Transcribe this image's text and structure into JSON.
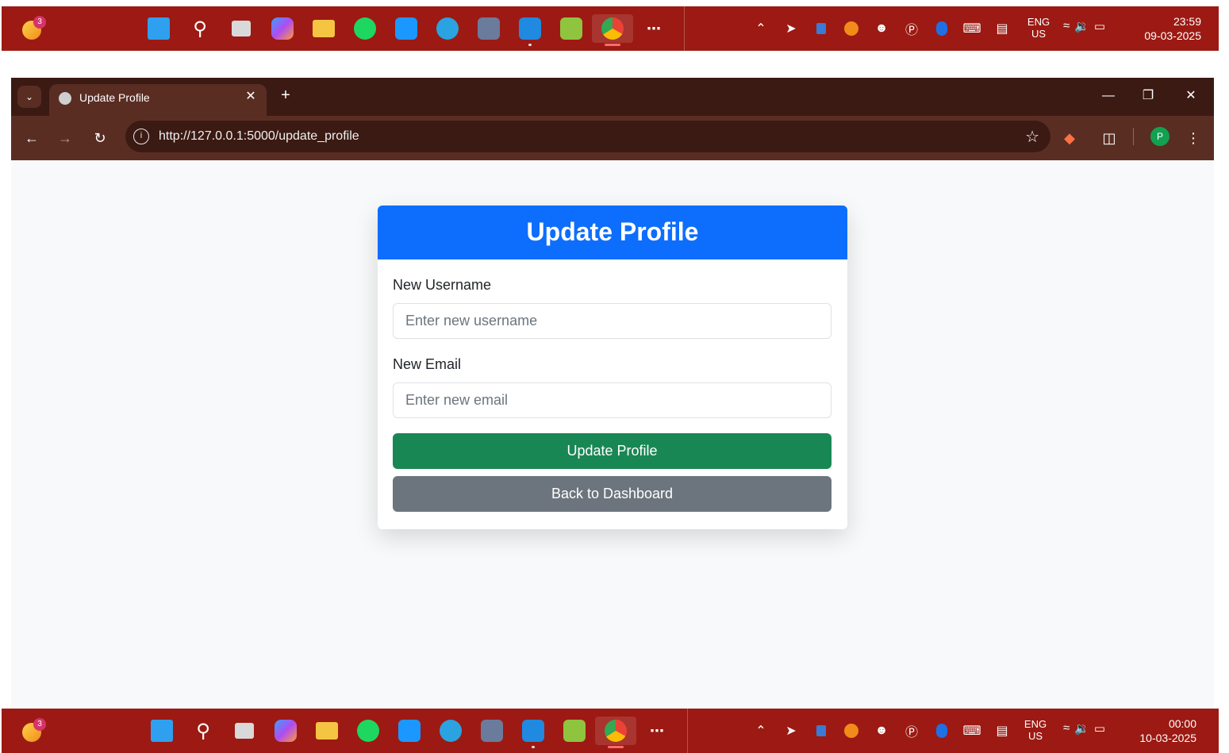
{
  "taskbar_top": {
    "notification_count": "3",
    "lang_line1": "ENG",
    "lang_line2": "US",
    "time": "23:59",
    "date": "09-03-2025"
  },
  "taskbar_bottom": {
    "notification_count": "3",
    "lang_line1": "ENG",
    "lang_line2": "US",
    "time": "00:00",
    "date": "10-03-2025"
  },
  "taskbar_apps": [
    "windows-start",
    "search",
    "task-view",
    "copilot",
    "file-explorer",
    "spotify",
    "prime-video",
    "telegram",
    "mysql-workbench",
    "vscode",
    "visual-studio",
    "chrome",
    "more"
  ],
  "browser": {
    "tab_title": "Update Profile",
    "url": "http://127.0.0.1:5000/update_profile",
    "profile_initial": "P"
  },
  "page": {
    "header": "Update Profile",
    "username_label": "New Username",
    "username_placeholder": "Enter new username",
    "email_label": "New Email",
    "email_placeholder": "Enter new email",
    "submit_label": "Update Profile",
    "back_label": "Back to Dashboard"
  },
  "colors": {
    "taskbar": "#9c1a13",
    "browser_frame": "#3b1a13",
    "header_blue": "#0d6efd",
    "success_green": "#198754",
    "secondary_gray": "#6c757d"
  }
}
